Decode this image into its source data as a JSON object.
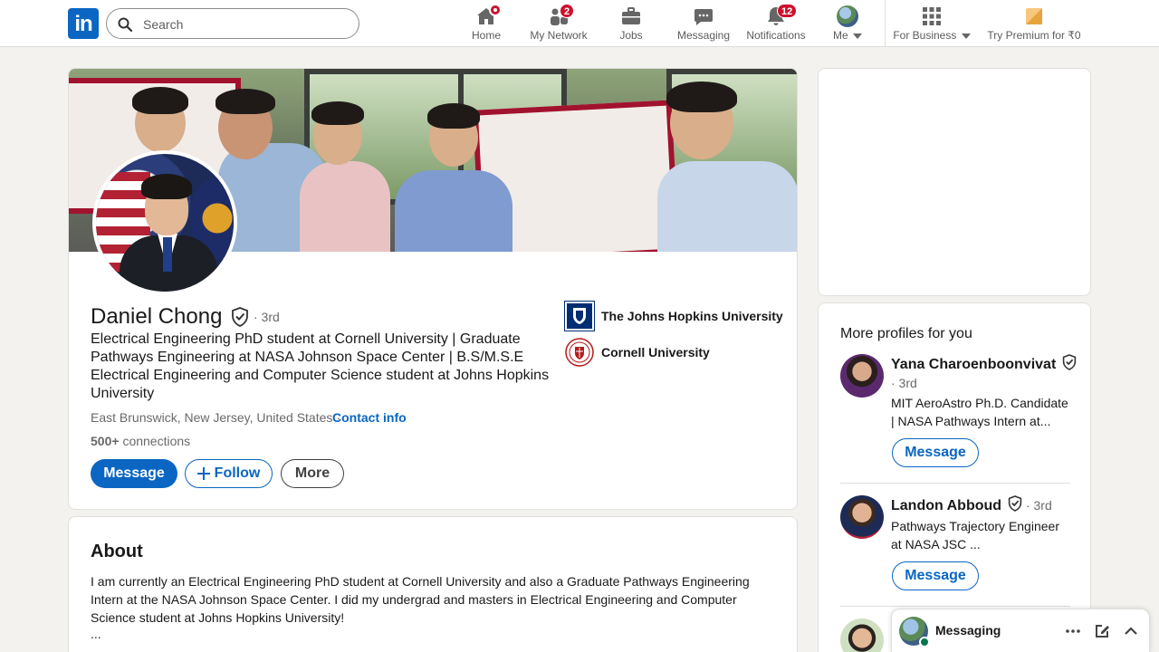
{
  "nav": {
    "logo_text": "in",
    "search_placeholder": "Search",
    "items": [
      {
        "label": "Home",
        "icon": "home-icon"
      },
      {
        "label": "My Network",
        "icon": "network-icon",
        "badge": "2"
      },
      {
        "label": "Jobs",
        "icon": "briefcase-icon"
      },
      {
        "label": "Messaging",
        "icon": "chat-icon"
      },
      {
        "label": "Notifications",
        "icon": "bell-icon",
        "badge": "12"
      },
      {
        "label": "Me",
        "icon": "avatar"
      },
      {
        "label": "For Business",
        "icon": "grid-icon"
      },
      {
        "label": "Try Premium for ₹0",
        "icon": "premium-icon"
      }
    ]
  },
  "profile": {
    "name": "Daniel Chong",
    "degree": "· 3rd",
    "headline": "Electrical Engineering PhD student at Cornell University | Graduate Pathways Engineering at NASA Johnson Space Center | B.S/M.S.E Electrical Engineering and Computer Science student at Johns Hopkins University",
    "location": "East Brunswick, New Jersey, United States ·",
    "contact_label": "Contact info",
    "connections_count": "500+",
    "connections_label": "connections",
    "buttons": {
      "message": "Message",
      "follow": "Follow",
      "more": "More"
    },
    "schools": [
      {
        "name": "The Johns Hopkins University"
      },
      {
        "name": "Cornell University"
      }
    ]
  },
  "about": {
    "title": "About",
    "text": "I am currently an Electrical Engineering PhD student at Cornell University and also a Graduate Pathways Engineering Intern at the NASA Johnson Space Center. I did my undergrad and masters in Electrical Engineering and Computer Science student at Johns Hopkins University!",
    "more": "..."
  },
  "more_profiles": {
    "title": "More profiles for you",
    "people": [
      {
        "name": "Yana Charoenboonvivat",
        "degree": "· 3rd",
        "headline": "MIT AeroAstro Ph.D. Candidate | NASA Pathways Intern at...",
        "button": "Message"
      },
      {
        "name": "Landon Abboud",
        "degree": "· 3rd",
        "headline": "Pathways Trajectory Engineer at NASA JSC ...",
        "button": "Message"
      }
    ]
  },
  "messaging": {
    "label": "Messaging"
  },
  "colors": {
    "brand": "#0a66c2",
    "badge": "#cb112d",
    "page_bg": "#f4f2ee"
  }
}
